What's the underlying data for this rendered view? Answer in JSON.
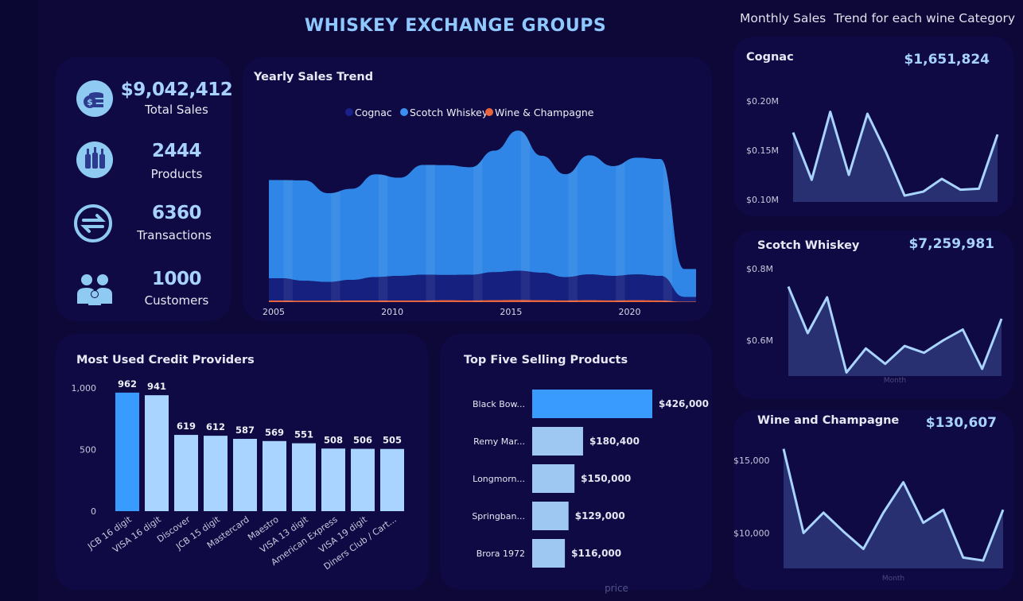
{
  "title": "WHISKEY EXCHANGE GROUPS",
  "monthly_title": "Monthly Sales  Trend for each wine Category",
  "kpis": [
    {
      "value": "$9,042,412",
      "label": "Total Sales",
      "icon": "money-bag-icon"
    },
    {
      "value": "2444",
      "label": "Products",
      "icon": "bottles-icon"
    },
    {
      "value": "6360",
      "label": "Transactions",
      "icon": "exchange-arrows-icon"
    },
    {
      "value": "1000",
      "label": "Customers",
      "icon": "customers-icon"
    }
  ],
  "colors": {
    "background": "#0d0838",
    "card": "#0f0a44",
    "cognac": "#1a1f8a",
    "scotch": "#3a8ff0",
    "wine": "#e8643c",
    "bar_highlight": "#3a9bff",
    "bar_light": "#a8d4ff",
    "line": "#a8d4ff",
    "kpi_value": "#a7d2ff"
  },
  "yearly": {
    "title": "Yearly Sales Trend",
    "legend": [
      "Cognac",
      "Scotch Whiskey",
      "Wine & Champagne"
    ]
  },
  "credit": {
    "title": "Most Used Credit Providers"
  },
  "top5": {
    "title": "Top Five Selling Products",
    "xlabel": "price"
  },
  "cognac": {
    "title": "Cognac",
    "total": "$1,651,824"
  },
  "scotch": {
    "title": "Scotch Whiskey",
    "total": "$7,259,981",
    "xlabel": "Month"
  },
  "wine": {
    "title": "Wine and Champagne",
    "total": "$130,607",
    "xlabel": "Month"
  },
  "chart_data": [
    {
      "id": "yearly",
      "type": "area",
      "title": "Yearly Sales Trend",
      "x": [
        2005,
        2006,
        2007,
        2008,
        2009,
        2010,
        2011,
        2012,
        2013,
        2014,
        2015,
        2016,
        2017,
        2018,
        2019,
        2020,
        2021,
        2022
      ],
      "xticks": [
        2005,
        2010,
        2015,
        2020
      ],
      "stacked": true,
      "legend_position": "top",
      "series": [
        {
          "name": "Wine & Champagne",
          "values": [
            7,
            6,
            6,
            7,
            7,
            7,
            7,
            8,
            7,
            8,
            9,
            8,
            7,
            8,
            7,
            8,
            7,
            2
          ]
        },
        {
          "name": "Cognac",
          "values": [
            95,
            85,
            80,
            88,
            100,
            105,
            110,
            108,
            110,
            120,
            125,
            118,
            100,
            110,
            105,
            110,
            105,
            20
          ]
        },
        {
          "name": "Scotch Whiskey",
          "values": [
            420,
            430,
            380,
            390,
            440,
            420,
            470,
            470,
            460,
            520,
            600,
            500,
            440,
            510,
            470,
            500,
            500,
            120
          ]
        }
      ],
      "ylim": [
        0,
        680
      ]
    },
    {
      "id": "credit",
      "type": "bar",
      "title": "Most Used Credit Providers",
      "categories": [
        "JCB 16 digit",
        "VISA 16 digit",
        "Discover",
        "JCB 15 digit",
        "Mastercard",
        "Maestro",
        "VISA 13 digit",
        "American Express",
        "VISA 19 digit",
        "Diners Club / Cart..."
      ],
      "values": [
        962,
        941,
        619,
        612,
        587,
        569,
        551,
        508,
        506,
        505
      ],
      "labels": [
        "962",
        "941",
        "619",
        "612",
        "587",
        "569",
        "551",
        "508",
        "506",
        "505"
      ],
      "yticks": [
        0,
        500,
        1000
      ],
      "ytick_labels": [
        "0",
        "500",
        "1,000"
      ],
      "ylim": [
        0,
        1000
      ]
    },
    {
      "id": "top5",
      "type": "bar",
      "orientation": "horizontal",
      "title": "Top Five Selling Products",
      "categories": [
        "Black Bow...",
        "Remy Mar...",
        "Longmorn...",
        "Springban...",
        "Brora 1972"
      ],
      "values": [
        426000,
        180400,
        150000,
        129000,
        116000
      ],
      "labels": [
        "$426,000",
        "$180,400",
        "$150,000",
        "$129,000",
        "$116,000"
      ],
      "xlabel": "price",
      "xlim": [
        0,
        426000
      ]
    },
    {
      "id": "cognac",
      "type": "area",
      "title": "Cognac",
      "x": [
        1,
        2,
        3,
        4,
        5,
        6,
        7,
        8,
        9,
        10,
        11,
        12
      ],
      "values": [
        0.168,
        0.12,
        0.189,
        0.125,
        0.187,
        0.148,
        0.104,
        0.108,
        0.121,
        0.11,
        0.111,
        0.166
      ],
      "yticks": [
        0.1,
        0.15,
        0.2
      ],
      "ytick_labels": [
        "$0.10M",
        "$0.15M",
        "$0.20M"
      ],
      "ylim": [
        0.1,
        0.2
      ]
    },
    {
      "id": "scotch",
      "type": "area",
      "title": "Scotch Whiskey",
      "xlabel": "Month",
      "x": [
        1,
        2,
        3,
        4,
        5,
        6,
        7,
        8,
        9,
        10,
        11,
        12,
        13
      ],
      "values": [
        0.75,
        0.62,
        0.72,
        0.51,
        0.577,
        0.534,
        0.584,
        0.565,
        0.6,
        0.63,
        0.52,
        0.66
      ],
      "yticks": [
        0.6,
        0.8
      ],
      "ytick_labels": [
        "$0.6M",
        "$0.8M"
      ],
      "ylim": [
        0.5,
        0.8
      ]
    },
    {
      "id": "wine",
      "type": "area",
      "title": "Wine and Champagne",
      "xlabel": "Month",
      "x": [
        1,
        2,
        3,
        4,
        5,
        6,
        7,
        8,
        9,
        10,
        11,
        12,
        13
      ],
      "values": [
        15800,
        10000,
        11400,
        10100,
        8900,
        11400,
        13500,
        10700,
        11600,
        8300,
        8100,
        11600
      ],
      "yticks": [
        10000,
        15000
      ],
      "ytick_labels": [
        "$10,000",
        "$15,000"
      ],
      "ylim": [
        7500,
        16000
      ]
    }
  ]
}
